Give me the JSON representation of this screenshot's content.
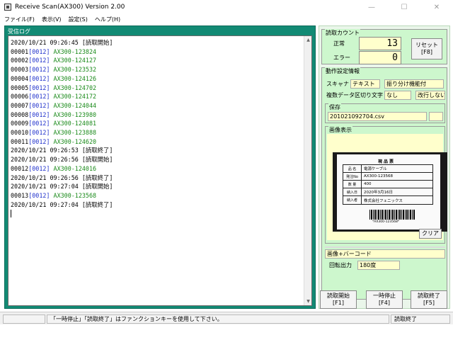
{
  "window": {
    "title": "Receive Scan(AX300) Version 2.00",
    "controls": {
      "minimize": "—",
      "maximize": "☐",
      "close": "✕"
    }
  },
  "menu": {
    "items": [
      "ファイル(F)",
      "表示(V)",
      "設定(S)",
      "ヘルプ(H)"
    ]
  },
  "log": {
    "caption": "受信ログ",
    "entries": [
      {
        "kind": "msg",
        "text": "2020/10/21 09:26:45 [読取開始]"
      },
      {
        "kind": "read",
        "seq": "00001",
        "tag": "[0012]",
        "code": " AX300-123824"
      },
      {
        "kind": "read",
        "seq": "00002",
        "tag": "[0012]",
        "code": " AX300-124127"
      },
      {
        "kind": "read",
        "seq": "00003",
        "tag": "[0012]",
        "code": " AX300-123532"
      },
      {
        "kind": "read",
        "seq": "00004",
        "tag": "[0012]",
        "code": " AX300-124126"
      },
      {
        "kind": "read",
        "seq": "00005",
        "tag": "[0012]",
        "code": " AX300-124702"
      },
      {
        "kind": "read",
        "seq": "00006",
        "tag": "[0012]",
        "code": " AX300-124172"
      },
      {
        "kind": "read",
        "seq": "00007",
        "tag": "[0012]",
        "code": " AX300-124044"
      },
      {
        "kind": "read",
        "seq": "00008",
        "tag": "[0012]",
        "code": " AX300-123980"
      },
      {
        "kind": "read",
        "seq": "00009",
        "tag": "[0012]",
        "code": " AX300-124081"
      },
      {
        "kind": "read",
        "seq": "00010",
        "tag": "[0012]",
        "code": " AX300-123888"
      },
      {
        "kind": "read",
        "seq": "00011",
        "tag": "[0012]",
        "code": " AX300-124620"
      },
      {
        "kind": "msg",
        "text": "2020/10/21 09:26:53 [読取終了]"
      },
      {
        "kind": "msg",
        "text": "2020/10/21 09:26:56 [読取開始]"
      },
      {
        "kind": "read",
        "seq": "00012",
        "tag": "[0012]",
        "code": " AX300-124016"
      },
      {
        "kind": "msg",
        "text": "2020/10/21 09:26:56 [読取終了]"
      },
      {
        "kind": "msg",
        "text": "2020/10/21 09:27:04 [読取開始]"
      },
      {
        "kind": "read",
        "seq": "00013",
        "tag": "[0012]",
        "code": " AX300-123568"
      },
      {
        "kind": "msg",
        "text": "2020/10/21 09:27:04 [読取終了]"
      }
    ]
  },
  "count": {
    "caption": "読取カウント",
    "normal_label": "正常",
    "normal_value": "13",
    "error_label": "エラー",
    "error_value": "0",
    "reset_line1": "リセット",
    "reset_line2": "[F8]"
  },
  "settings": {
    "caption": "動作設定情報",
    "scanner_label": "スキャナ",
    "scanner_value": "テキスト",
    "mode_value": "振り分け機能付",
    "multi_label": "複数データ区切り文字",
    "multi_value": "なし",
    "newline_value": "改行しない"
  },
  "save": {
    "caption": "保存",
    "filename": "201021092704.csv"
  },
  "image": {
    "caption": "画像表示",
    "clear_label": "クリア",
    "doc": {
      "title": "現品票",
      "rows": [
        {
          "k": "品 名",
          "v": "電源ケーブル"
        },
        {
          "k": "発注No",
          "v": "AX300-123568"
        },
        {
          "k": "数 量",
          "v": "400"
        },
        {
          "k": "納入日",
          "v": "2020年3月16日"
        },
        {
          "k": "納入者",
          "v": "株式会社フェニックス"
        }
      ],
      "barcode_text": "*AX300-123568*"
    }
  },
  "output": {
    "mode_value": "画像+バーコード",
    "rotate_label": "回転出力",
    "rotate_value": "180度"
  },
  "buttons": {
    "start_l1": "読取開始",
    "start_l2": "[F1]",
    "pause_l1": "一時停止",
    "pause_l2": "[F4]",
    "stop_l1": "読取終了",
    "stop_l2": "[F5]"
  },
  "status": {
    "hint": "「一時停止」「読取終了」はファンクションキーを使用して下さい。",
    "state": "読取終了"
  }
}
